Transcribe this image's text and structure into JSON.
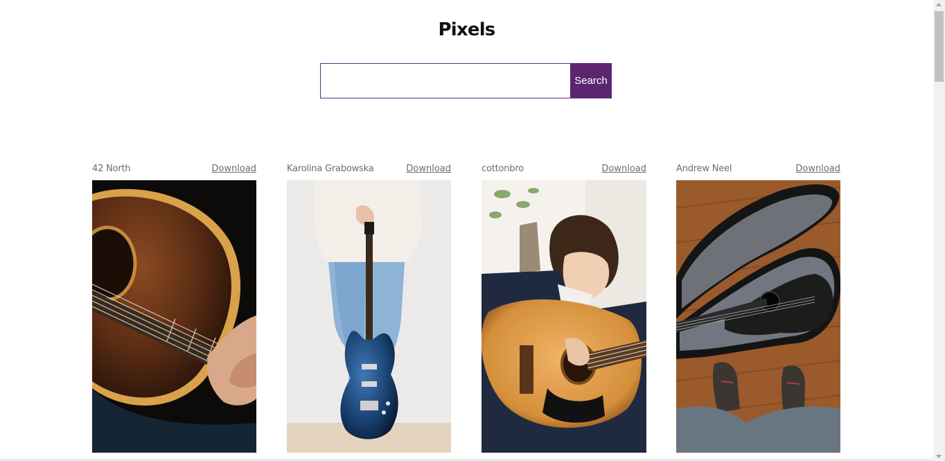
{
  "header": {
    "title": "Pixels"
  },
  "search": {
    "value": "",
    "placeholder": "",
    "button_label": "Search"
  },
  "photos": [
    {
      "author": "42 North",
      "download_label": "Download",
      "subject": "acoustic guitar close-up"
    },
    {
      "author": "Karolina Grabowska",
      "download_label": "Download",
      "subject": "person holding electric guitar"
    },
    {
      "author": "cottonbro",
      "download_label": "Download",
      "subject": "boy playing acoustic guitar"
    },
    {
      "author": "Andrew Neel",
      "download_label": "Download",
      "subject": "guitar in open case on wooden floor"
    }
  ],
  "colors": {
    "accent": "#5b2570",
    "text_muted": "#6b6b6b"
  }
}
